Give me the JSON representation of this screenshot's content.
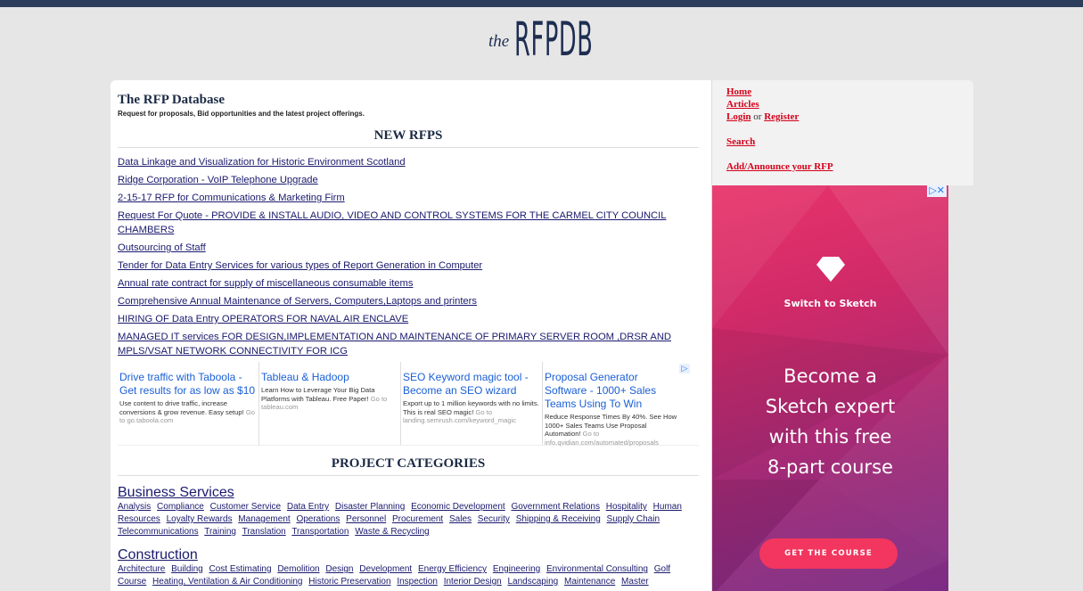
{
  "logo": {
    "the": "the",
    "main": "RFPDB"
  },
  "header": {
    "title": "The RFP Database",
    "tagline": "Request for proposals, Bid opportunities and the latest project offerings."
  },
  "new_rfps": {
    "heading": "NEW RFPS",
    "items": [
      "Data Linkage and Visualization for Historic Environment Scotland",
      "Ridge Corporation - VoIP Telephone Upgrade",
      "2-15-17 RFP for Communications & Marketing Firm",
      "Request For Quote - PROVIDE & INSTALL AUDIO, VIDEO AND CONTROL SYSTEMS FOR THE CARMEL CITY COUNCIL CHAMBERS",
      "Outsourcing of Staff",
      "Tender for Data Entry Services for various types of Report Generation in Computer",
      "Annual rate contract for supply of miscellaneous consumable items",
      "Comprehensive Annual Maintenance of Servers, Computers,Laptops and printers",
      "HIRING OF Data Entry OPERATORS FOR NAVAL AIR ENCLAVE",
      "MANAGED IT services FOR DESIGN,IMPLEMENTATION AND MAINTENANCE OF PRIMARY SERVER ROOM ,DRSR AND MPLS/VSAT NETWORK CONNECTIVITY FOR ICG"
    ]
  },
  "ads": [
    {
      "title": "Drive traffic with Taboola - Get results for as low as $10",
      "body": "Use content to drive traffic, increase conversions & grow revenue. Easy setup!",
      "go": "Go to go.taboola.com"
    },
    {
      "title": "Tableau & Hadoop",
      "body": "Learn How to Leverage Your Big Data Platforms with Tableau. Free Paper!",
      "go": "Go to tableau.com"
    },
    {
      "title": "SEO Keyword magic tool - Become an SEO wizard",
      "body": "Export up to 1 million keywords with no limits. This is real SEO magic!",
      "go": "Go to landing.semrush.com/keyword_magic"
    },
    {
      "title": "Proposal Generator Software - 1000+ Sales Teams Using To Win",
      "body": "Reduce Response Times By 40%. See How 1000+ Sales Teams Use Proposal Automation!",
      "go": "Go to info.qvidian.com/automated/proposals"
    }
  ],
  "categories": {
    "heading": "PROJECT CATEGORIES",
    "groups": [
      {
        "title": "Business Services",
        "links": [
          "Analysis",
          "Compliance",
          "Customer Service",
          "Data Entry",
          "Disaster Planning",
          "Economic Development",
          "Government Relations",
          "Hospitality",
          "Human Resources",
          "Loyalty Rewards",
          "Management",
          "Operations",
          "Personnel",
          "Procurement",
          "Sales",
          "Security",
          "Shipping & Receiving",
          "Supply Chain",
          "Telecommunications",
          "Training",
          "Translation",
          "Transportation",
          "Waste & Recycling"
        ]
      },
      {
        "title": "Construction",
        "links": [
          "Architecture",
          "Building",
          "Cost Estimating",
          "Demolition",
          "Design",
          "Development",
          "Energy Efficiency",
          "Engineering",
          "Environmental Consulting",
          "Golf Course",
          "Heating, Ventilation & Air Conditioning",
          "Historic Preservation",
          "Inspection",
          "Interior Design",
          "Landscaping",
          "Maintenance",
          "Master"
        ]
      }
    ]
  },
  "sidebar": {
    "home": "Home",
    "articles": "Articles",
    "login": "Login",
    "or": "or",
    "register": "Register",
    "search": "Search",
    "add": "Add/Announce your RFP"
  },
  "sketch_ad": {
    "switch": "Switch to Sketch",
    "line1": "Become a",
    "line2": "Sketch expert",
    "line3": "with this free",
    "line4": "8-part course",
    "cta": "GET THE COURSE",
    "colors": {
      "top": "#e9346b",
      "bottom": "#7b2c86",
      "button": "#f2365f"
    }
  }
}
